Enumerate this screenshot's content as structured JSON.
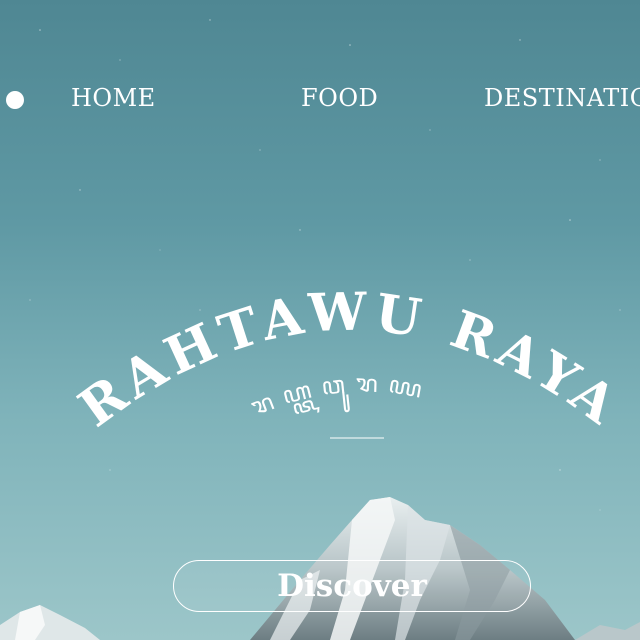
{
  "nav": {
    "items": [
      {
        "label": "HOME"
      },
      {
        "label": "FOOD"
      },
      {
        "label": "DESTINATIO"
      }
    ]
  },
  "hero": {
    "title": "RAHTAWU RAYA",
    "script_title": "ꦫꦲ꧀ꦠꦮꦸꦫꦪ",
    "cta_label": "Discover"
  },
  "colors": {
    "sky_top": "#4f8793",
    "sky_bottom": "#9cc6c9",
    "text": "#ffffff"
  },
  "icons": {
    "nav_marker": "circle-dot-icon"
  }
}
